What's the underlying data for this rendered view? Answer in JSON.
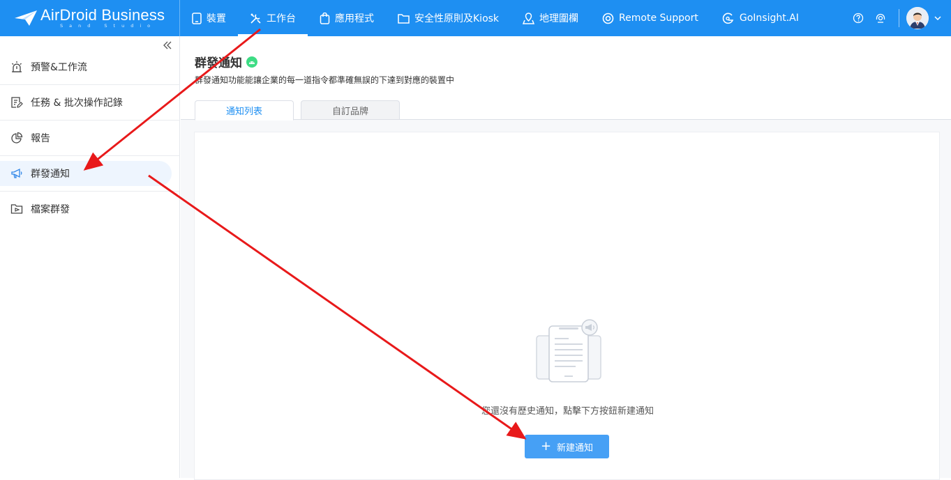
{
  "header": {
    "brand_name": "AirDroid Business",
    "brand_sub": "Sand Studio",
    "nav": [
      {
        "label": "裝置",
        "icon": "tablet-icon"
      },
      {
        "label": "工作台",
        "icon": "tools-icon"
      },
      {
        "label": "應用程式",
        "icon": "app-bag-icon"
      },
      {
        "label": "安全性原則及Kiosk",
        "icon": "folder-icon"
      },
      {
        "label": "地理圍欄",
        "icon": "map-pin-icon"
      },
      {
        "label": "Remote Support",
        "icon": "lifebuoy-icon"
      },
      {
        "label": "GoInsight.AI",
        "icon": "goinsight-icon"
      }
    ],
    "active_nav": "工作台"
  },
  "sidebar": {
    "items": [
      {
        "label": "預警&工作流",
        "icon": "alarm-icon"
      },
      {
        "label": "任務 & 批次操作記錄",
        "icon": "task-log-icon"
      },
      {
        "label": "報告",
        "icon": "pie-chart-icon"
      },
      {
        "label": "群發通知",
        "icon": "megaphone-icon"
      },
      {
        "label": "檔案群發",
        "icon": "file-send-icon"
      }
    ],
    "active": "群發通知"
  },
  "main": {
    "title": "群發通知",
    "description": "群發通知功能能讓企業的每一道指令都準確無誤的下達到對應的裝置中",
    "tabs": [
      {
        "label": "通知列表"
      },
      {
        "label": "自訂品牌"
      }
    ],
    "empty_text": "您還沒有歷史通知，點擊下方按鈕新建通知",
    "new_button": "新建通知"
  },
  "colors": {
    "header_bg": "#1e8ff2",
    "accent": "#1e8ff2",
    "button": "#46a0f5",
    "annotation_arrow": "#e8191a",
    "android_green": "#3ddc84"
  }
}
